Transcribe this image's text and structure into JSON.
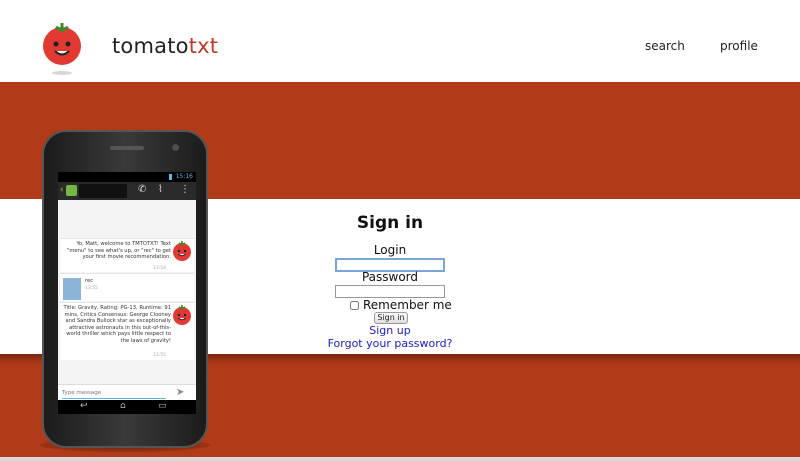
{
  "header": {
    "brand_main": "tomato",
    "brand_accent": "txt",
    "nav": {
      "search": "search",
      "profile": "profile"
    }
  },
  "signin": {
    "title": "Sign in",
    "login_label": "Login",
    "login_value": "",
    "password_label": "Password",
    "password_value": "",
    "remember_label": "Remember me",
    "submit_label": "Sign in",
    "signup_link": "Sign up",
    "forgot_link": "Forgot your password?"
  },
  "phone": {
    "status_time": "15:16",
    "messages": [
      {
        "text": "Yo, Matt, welcome to TMTOTXT! Text \"menu\" to see what's up, or \"rec\" to get your first movie recommendation.",
        "time": "13:54"
      },
      {
        "text": "rec",
        "time": "13:55"
      },
      {
        "text": "Title: Gravity, Rating: PG-13, Runtime: 91 mins, Critics Consensus: George Clooney and Sandra Bullock star as exceptionally attractive astronauts in this out-of-this-world thriller which pays little respect to the laws of gravity!",
        "time": "13:55"
      }
    ],
    "composer_placeholder": "Type message"
  },
  "colors": {
    "brand_red": "#b13a18",
    "accent": "#c0392b",
    "link": "#1c1cc8"
  }
}
